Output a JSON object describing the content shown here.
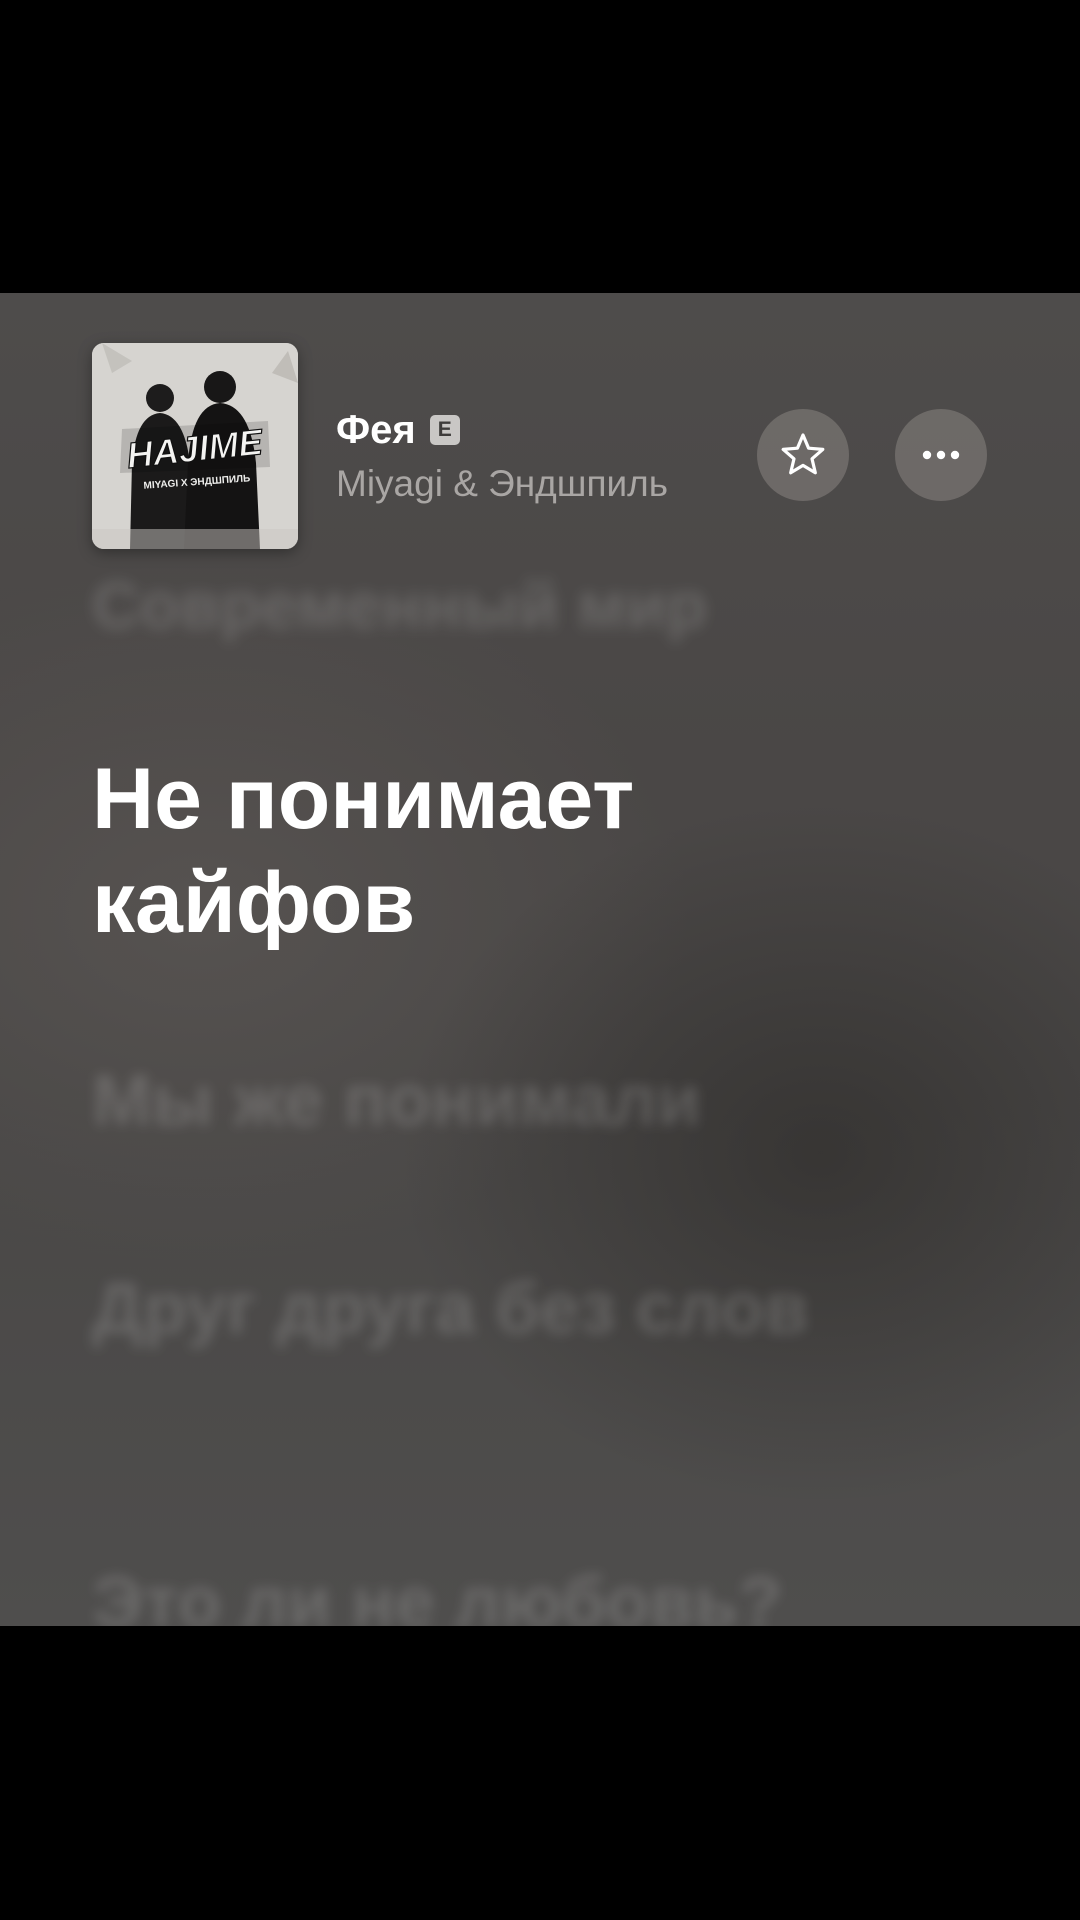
{
  "track": {
    "title": "Фея",
    "explicit_badge": "E",
    "artist": "Miyagi & Эндшпиль"
  },
  "album_art": {
    "title_text": "HAJIME",
    "artists_text": "MIYAGI X ЭНДШПИЛЬ"
  },
  "actions": {
    "favorite_icon": "star-outline-icon",
    "more_icon": "ellipsis-icon"
  },
  "lyrics": {
    "previous": "Современный мир",
    "current": "Не понимает кайфов",
    "upcoming": [
      "Мы же понимали",
      "Друг друга без слов",
      "Это ли не любовь?"
    ]
  },
  "colors": {
    "background": "#4a4746",
    "current_lyric": "#ffffff",
    "dim_lyric": "rgba(255,255,255,0.16)",
    "artist_text": "#a9a6a4"
  }
}
